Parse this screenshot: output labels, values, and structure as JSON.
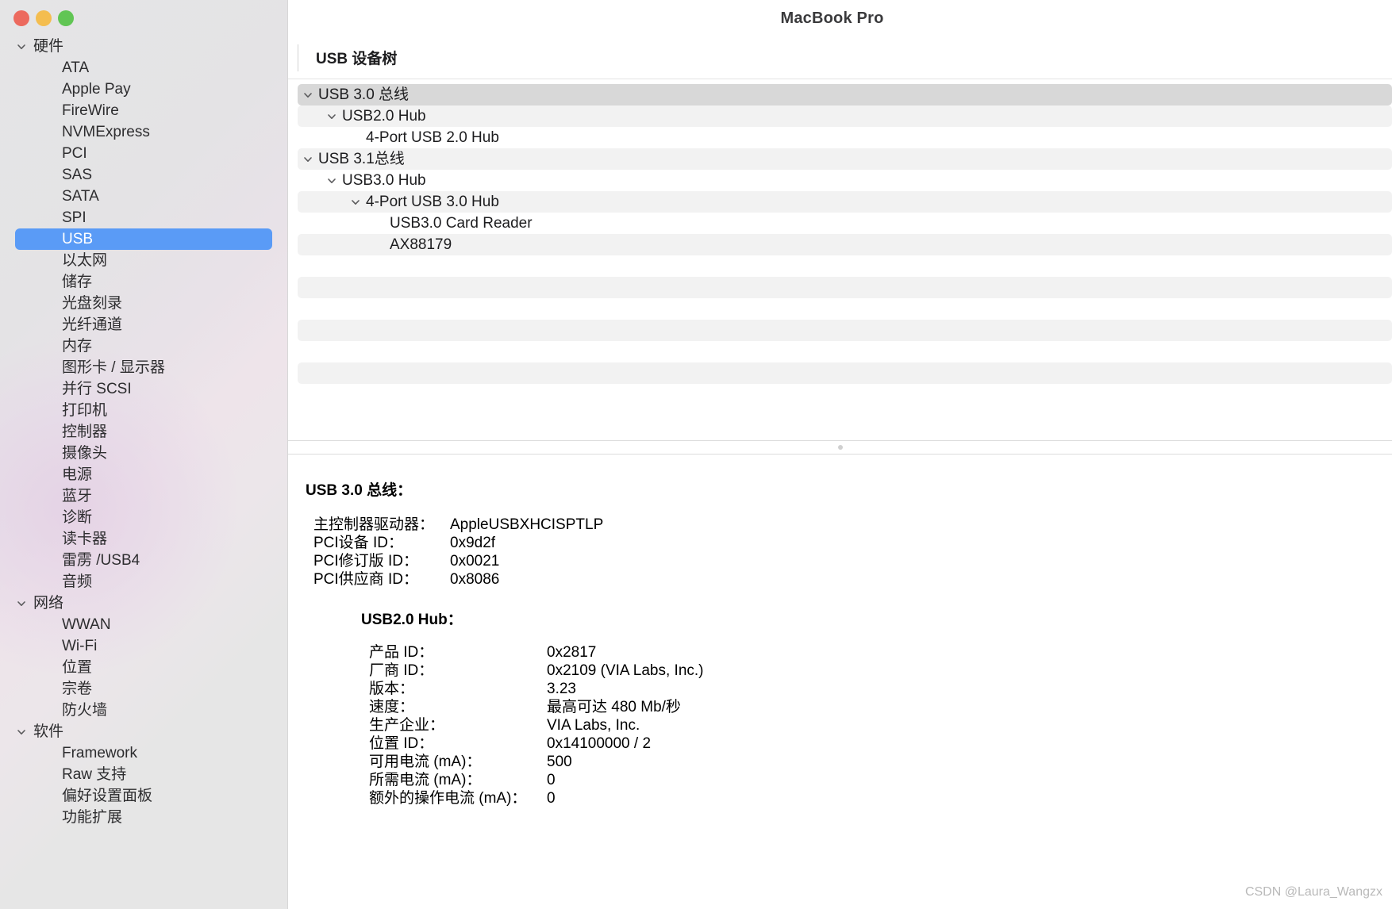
{
  "window": {
    "title": "MacBook Pro",
    "traffic_lights": {
      "close": "close-button",
      "minimize": "minimize-button",
      "maximize": "maximize-button"
    }
  },
  "sidebar": {
    "items": [
      {
        "label": "硬件",
        "type": "group",
        "expanded": true,
        "selected": false
      },
      {
        "label": "ATA",
        "type": "child",
        "selected": false
      },
      {
        "label": "Apple Pay",
        "type": "child",
        "selected": false
      },
      {
        "label": "FireWire",
        "type": "child",
        "selected": false
      },
      {
        "label": "NVMExpress",
        "type": "child",
        "selected": false
      },
      {
        "label": "PCI",
        "type": "child",
        "selected": false
      },
      {
        "label": "SAS",
        "type": "child",
        "selected": false
      },
      {
        "label": "SATA",
        "type": "child",
        "selected": false
      },
      {
        "label": "SPI",
        "type": "child",
        "selected": false
      },
      {
        "label": "USB",
        "type": "child",
        "selected": true
      },
      {
        "label": "以太网",
        "type": "child",
        "selected": false
      },
      {
        "label": "储存",
        "type": "child",
        "selected": false
      },
      {
        "label": "光盘刻录",
        "type": "child",
        "selected": false
      },
      {
        "label": "光纤通道",
        "type": "child",
        "selected": false
      },
      {
        "label": "内存",
        "type": "child",
        "selected": false
      },
      {
        "label": "图形卡 / 显示器",
        "type": "child",
        "selected": false
      },
      {
        "label": "并行 SCSI",
        "type": "child",
        "selected": false
      },
      {
        "label": "打印机",
        "type": "child",
        "selected": false
      },
      {
        "label": "控制器",
        "type": "child",
        "selected": false
      },
      {
        "label": "摄像头",
        "type": "child",
        "selected": false
      },
      {
        "label": "电源",
        "type": "child",
        "selected": false
      },
      {
        "label": "蓝牙",
        "type": "child",
        "selected": false
      },
      {
        "label": "诊断",
        "type": "child",
        "selected": false
      },
      {
        "label": "读卡器",
        "type": "child",
        "selected": false
      },
      {
        "label": "雷雳 /USB4",
        "type": "child",
        "selected": false
      },
      {
        "label": "音频",
        "type": "child",
        "selected": false
      },
      {
        "label": "网络",
        "type": "group",
        "expanded": true,
        "selected": false
      },
      {
        "label": "WWAN",
        "type": "child",
        "selected": false
      },
      {
        "label": "Wi-Fi",
        "type": "child",
        "selected": false
      },
      {
        "label": "位置",
        "type": "child",
        "selected": false
      },
      {
        "label": "宗卷",
        "type": "child",
        "selected": false
      },
      {
        "label": "防火墙",
        "type": "child",
        "selected": false
      },
      {
        "label": "软件",
        "type": "group",
        "expanded": true,
        "selected": false
      },
      {
        "label": "Framework",
        "type": "child",
        "selected": false
      },
      {
        "label": "Raw 支持",
        "type": "child",
        "selected": false
      },
      {
        "label": "偏好设置面板",
        "type": "child",
        "selected": false
      },
      {
        "label": "功能扩展",
        "type": "child",
        "selected": false
      }
    ]
  },
  "tree": {
    "header": "USB 设备树",
    "rows": [
      {
        "label": "USB 3.0 总线",
        "depth": 0,
        "expandable": true,
        "expanded": true,
        "selected": true,
        "stripe": false
      },
      {
        "label": "USB2.0 Hub",
        "depth": 1,
        "expandable": true,
        "expanded": true,
        "selected": false,
        "stripe": true
      },
      {
        "label": "4-Port USB 2.0 Hub",
        "depth": 2,
        "expandable": false,
        "expanded": false,
        "selected": false,
        "stripe": false
      },
      {
        "label": "USB 3.1总线",
        "depth": 0,
        "expandable": true,
        "expanded": true,
        "selected": false,
        "stripe": true
      },
      {
        "label": "USB3.0 Hub",
        "depth": 1,
        "expandable": true,
        "expanded": true,
        "selected": false,
        "stripe": false
      },
      {
        "label": "4-Port USB 3.0 Hub",
        "depth": 2,
        "expandable": true,
        "expanded": true,
        "selected": false,
        "stripe": true
      },
      {
        "label": "USB3.0 Card Reader",
        "depth": 3,
        "expandable": false,
        "expanded": false,
        "selected": false,
        "stripe": false
      },
      {
        "label": "AX88179",
        "depth": 3,
        "expandable": false,
        "expanded": false,
        "selected": false,
        "stripe": true
      },
      {
        "label": "",
        "depth": 0,
        "expandable": false,
        "expanded": false,
        "selected": false,
        "stripe": false
      },
      {
        "label": "",
        "depth": 0,
        "expandable": false,
        "expanded": false,
        "selected": false,
        "stripe": true
      },
      {
        "label": "",
        "depth": 0,
        "expandable": false,
        "expanded": false,
        "selected": false,
        "stripe": false
      },
      {
        "label": "",
        "depth": 0,
        "expandable": false,
        "expanded": false,
        "selected": false,
        "stripe": true
      },
      {
        "label": "",
        "depth": 0,
        "expandable": false,
        "expanded": false,
        "selected": false,
        "stripe": false
      },
      {
        "label": "",
        "depth": 0,
        "expandable": false,
        "expanded": false,
        "selected": false,
        "stripe": true
      },
      {
        "label": "",
        "depth": 0,
        "expandable": false,
        "expanded": false,
        "selected": false,
        "stripe": false
      }
    ]
  },
  "detail": {
    "title": "USB 3.0 总线：",
    "bus_props": [
      {
        "key": "主控制器驱动器：",
        "value": "AppleUSBXHCISPTLP"
      },
      {
        "key": "PCI设备 ID：",
        "value": "0x9d2f"
      },
      {
        "key": "PCI修订版 ID：",
        "value": "0x0021"
      },
      {
        "key": "PCI供应商 ID：",
        "value": "0x8086"
      }
    ],
    "device_title": "USB2.0 Hub：",
    "device_props": [
      {
        "key": "产品 ID：",
        "value": "0x2817"
      },
      {
        "key": "厂商 ID：",
        "value": "0x2109  (VIA Labs, Inc.)"
      },
      {
        "key": "版本：",
        "value": "3.23"
      },
      {
        "key": "速度：",
        "value": "最高可达 480 Mb/秒"
      },
      {
        "key": "生产企业：",
        "value": "VIA Labs, Inc."
      },
      {
        "key": "位置 ID：",
        "value": "0x14100000 / 2"
      },
      {
        "key": "可用电流 (mA)：",
        "value": "500"
      },
      {
        "key": "所需电流 (mA)：",
        "value": "0"
      },
      {
        "key": "额外的操作电流 (mA)：",
        "value": "0"
      }
    ]
  },
  "watermark": "CSDN @Laura_Wangzx",
  "colors": {
    "selection_blue": "#5a9bf6",
    "tree_selected_gray": "#d8d8d8",
    "stripe_gray": "#f2f2f2",
    "traffic_red": "#ec6a5e",
    "traffic_yellow": "#f4bd4f",
    "traffic_green": "#61c554"
  }
}
